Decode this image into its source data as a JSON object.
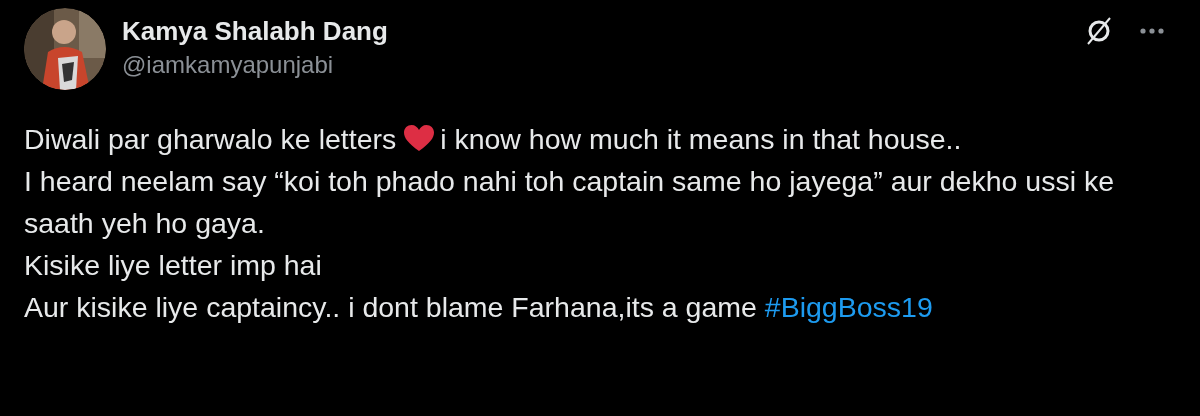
{
  "author": {
    "name": "Kamya Shalabh Dang",
    "handle": "@iamkamyapunjabi"
  },
  "body": [
    {
      "parts": [
        {
          "kind": "text",
          "text": "Diwali par gharwalo ke letters"
        },
        {
          "kind": "heart"
        },
        {
          "kind": "text",
          "text": "i know how much it means in that house.."
        }
      ]
    },
    {
      "parts": [
        {
          "kind": "text",
          "text": "I heard neelam say “koi toh phado nahi toh captain same ho jayega” aur dekho ussi ke saath yeh ho gaya."
        }
      ]
    },
    {
      "parts": [
        {
          "kind": "text",
          "text": "Kisike liye letter imp hai"
        }
      ]
    },
    {
      "parts": [
        {
          "kind": "text",
          "text": "Aur kisike liye captaincy.. i dont blame Farhana,its a game"
        },
        {
          "kind": "hashtag",
          "text": "#BiggBoss19"
        }
      ]
    }
  ]
}
